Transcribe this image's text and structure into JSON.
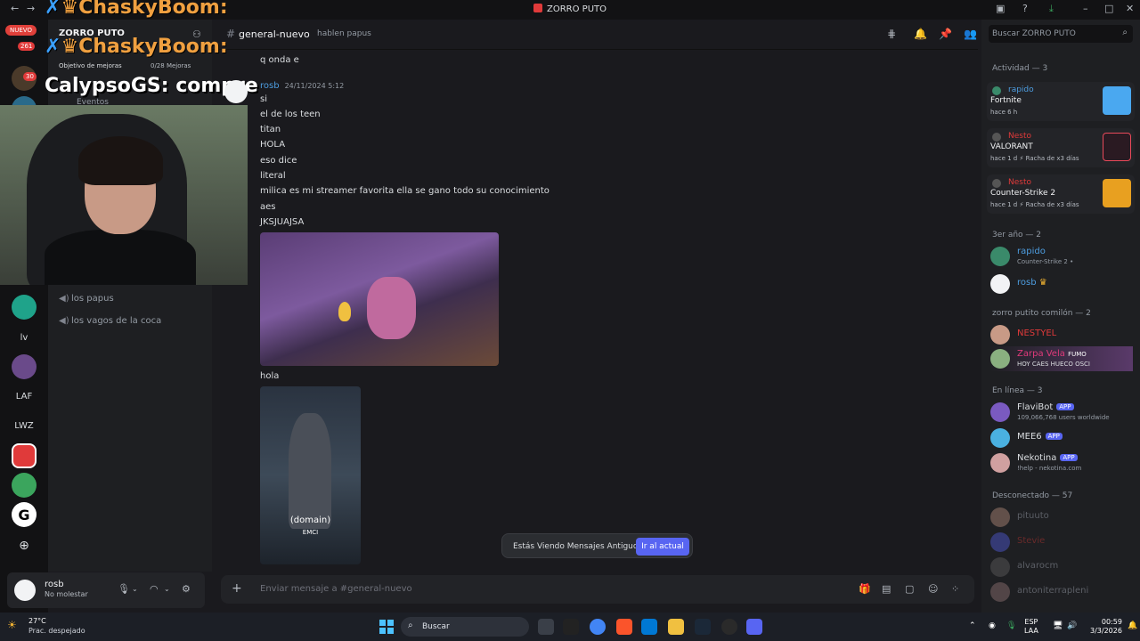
{
  "titlebar": {
    "title": "ZORRO PUTO"
  },
  "servers": {
    "new_badge": "NUEVO",
    "badge_261": "261",
    "badge_30": "30",
    "labels": [
      "lv",
      "LAF",
      "LWZ",
      "G"
    ]
  },
  "channels": {
    "server_name": "ZORRO PUTO",
    "boost_goal": "Objetivo de mejoras",
    "boost_count": "0/28 Mejoras",
    "events": "Eventos",
    "voice": [
      "los papus",
      "los vagos de la coca"
    ]
  },
  "user": {
    "name": "rosb",
    "status": "No molestar"
  },
  "channel_header": {
    "name": "general-nuevo",
    "topic": "hablen papus"
  },
  "messages": {
    "prev_line": "q onda e",
    "author": "rosb",
    "timestamp": "24/11/2024 5:12",
    "lines": [
      "si",
      "el de los teen",
      "titan",
      "HOLA",
      "eso dice",
      "literal",
      "milica es mi streamer favorita ella se gano todo su conocimiento",
      "aes",
      "JKSJUAJSA"
    ],
    "after_image": "hola",
    "video_caption": "(domain)",
    "video_caption2": "EMCI"
  },
  "old_messages_bar": {
    "text": "Estás Viendo Mensajes Antiguos",
    "jump": "Ir al actual"
  },
  "composer": {
    "placeholder": "Enviar mensaje a #general-nuevo"
  },
  "members": {
    "search_placeholder": "Buscar ZORRO PUTO",
    "activity_header": "Actividad — 3",
    "activities": [
      {
        "who": "rapido",
        "game": "Fortnite",
        "meta": "hace 6 h",
        "streak": ""
      },
      {
        "who": "Nesto",
        "game": "VALORANT",
        "meta": "hace 1 d",
        "streak": "Racha de x3 días"
      },
      {
        "who": "Nesto",
        "game": "Counter-Strike 2",
        "meta": "hace 1 d",
        "streak": "Racha de x3 días"
      }
    ],
    "role1_header": "3er año — 2",
    "role1": [
      {
        "name": "rapido",
        "sub": "Counter-Strike 2 •"
      },
      {
        "name": "rosb",
        "sub": ""
      }
    ],
    "role2_header": "zorro putito comilón — 2",
    "role2": [
      {
        "name": "NESTYEL",
        "sub": ""
      },
      {
        "name": "Zarpa Vela",
        "tag": "FUMO",
        "sub": "HOY CAES HUECO OSCI"
      }
    ],
    "online_header": "En línea — 3",
    "online": [
      {
        "name": "FlaviBot",
        "badge": "APP",
        "sub": "109,066,768 users worldwide"
      },
      {
        "name": "MEE6",
        "badge": "APP",
        "sub": ""
      },
      {
        "name": "Nekotina",
        "badge": "APP",
        "sub": "!help - nekotina.com"
      }
    ],
    "offline_header": "Desconectado — 57",
    "offline": [
      "pituuto",
      "Stevie",
      "alvarocm",
      "antoniterrapleni"
    ]
  },
  "overlay": {
    "stream_name": "ChaskyBoom:",
    "chat_name": "CalypsoGS:",
    "chat_text": "compre"
  },
  "taskbar": {
    "temp": "27°C",
    "weather": "Prac. despejado",
    "search": "Buscar",
    "lang1": "ESP",
    "lang2": "LAA",
    "time": "00:59",
    "date": "3/3/2026"
  }
}
